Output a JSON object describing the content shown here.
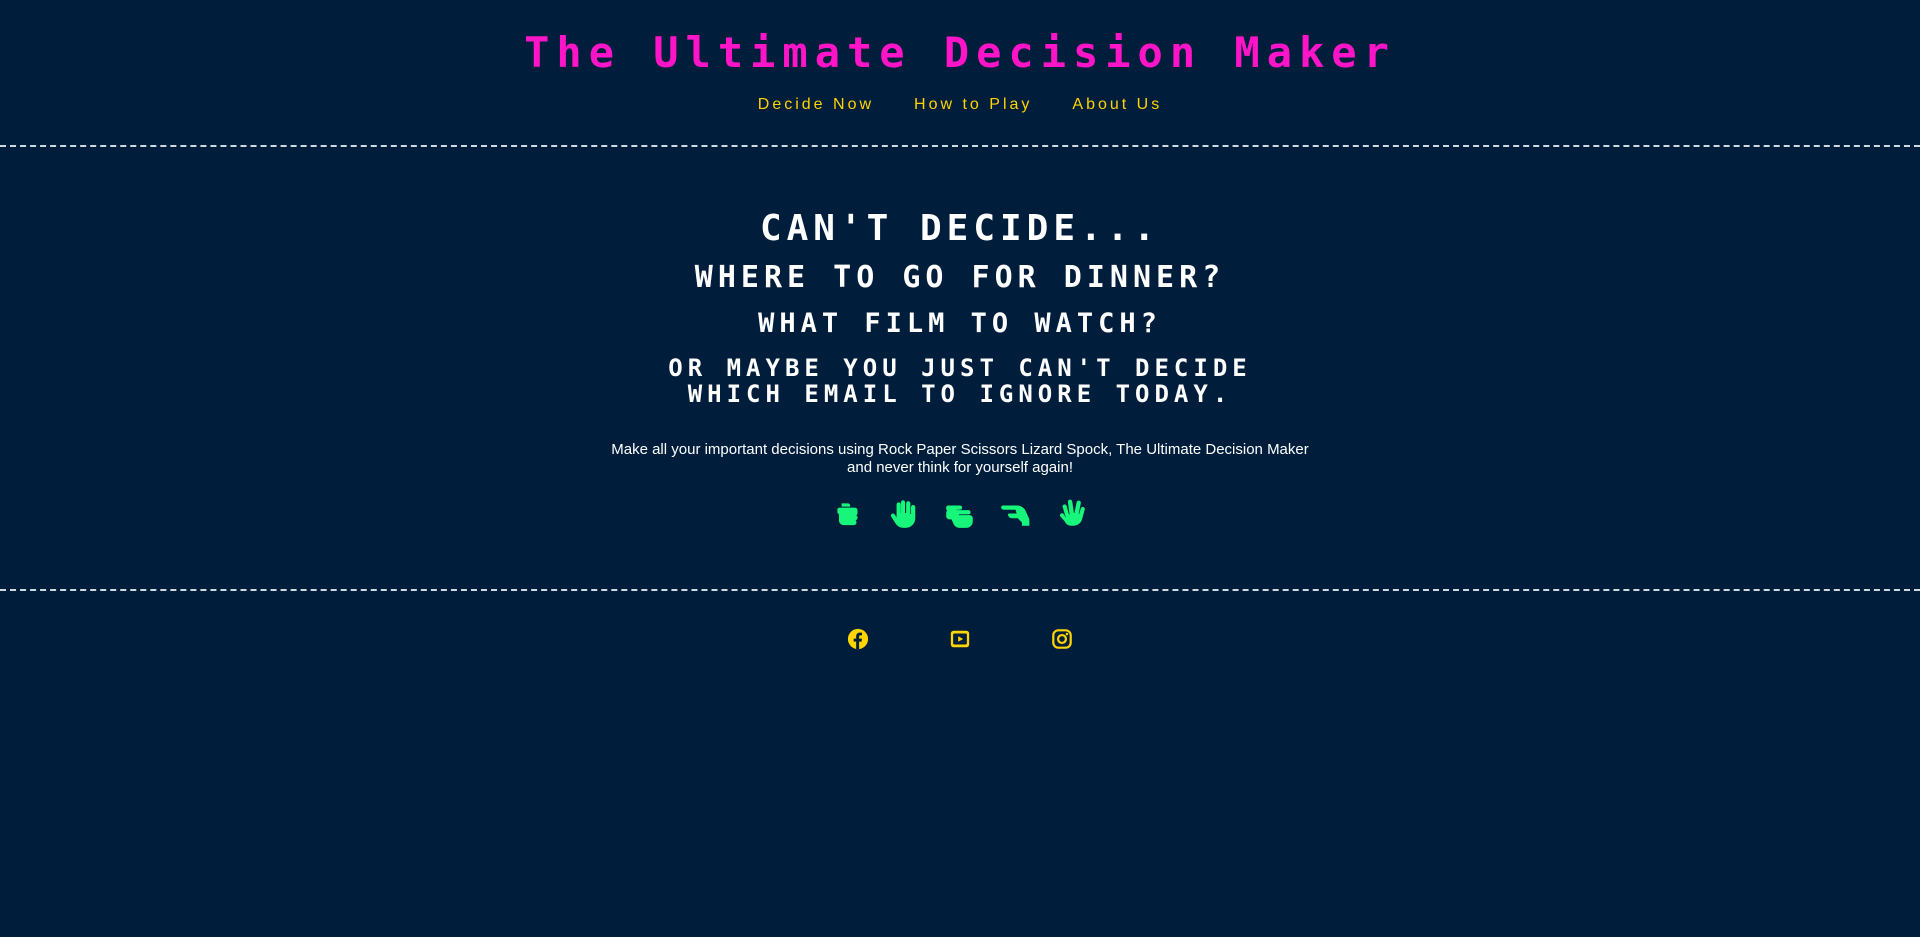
{
  "header": {
    "title": "The Ultimate Decision Maker",
    "nav": [
      {
        "label": "Decide Now"
      },
      {
        "label": "How to Play"
      },
      {
        "label": "About Us"
      }
    ]
  },
  "hero": {
    "line1": "Can't decide...",
    "line2": "Where to go for dinner?",
    "line3": "What film to watch?",
    "line4a": "Or maybe you just can't decide",
    "line4b": "which email to ignore today.",
    "tagline_a": "Make all your important decisions using Rock Paper Scissors Lizard Spock, The Ultimate Decision Maker",
    "tagline_b": "and never think for yourself again!",
    "hands": [
      {
        "icon": "hand-rock-icon"
      },
      {
        "icon": "hand-paper-icon"
      },
      {
        "icon": "hand-scissors-icon"
      },
      {
        "icon": "hand-lizard-icon"
      },
      {
        "icon": "hand-spock-icon"
      }
    ]
  },
  "footer": {
    "social": [
      {
        "icon": "facebook-icon"
      },
      {
        "icon": "youtube-icon"
      },
      {
        "icon": "instagram-icon"
      }
    ]
  },
  "colors": {
    "background": "#001e3c",
    "title": "#ff14c8",
    "nav": "#ffd400",
    "hands": "#17f57a",
    "social": "#ffd400"
  }
}
